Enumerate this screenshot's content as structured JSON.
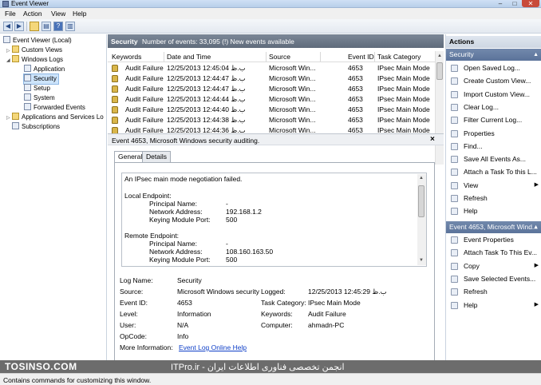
{
  "window": {
    "title": "Event Viewer",
    "minimize": "–",
    "maximize": "□",
    "close": "✕"
  },
  "menu": [
    "File",
    "Action",
    "View",
    "Help"
  ],
  "tree": {
    "root": "Event Viewer (Local)",
    "custom_views": "Custom Views",
    "windows_logs": "Windows Logs",
    "application": "Application",
    "security": "Security",
    "setup": "Setup",
    "system": "System",
    "forwarded": "Forwarded Events",
    "app_services": "Applications and Services Lo",
    "subscriptions": "Subscriptions"
  },
  "list": {
    "log_name": "Security",
    "summary": "Number of events: 33,095 (!) New events available",
    "columns": [
      "Keywords",
      "Date and Time",
      "Source",
      "Event ID",
      "Task Category"
    ],
    "rows": [
      [
        "Audit Failure",
        "12/25/2013 12:45:04 ب.ظ",
        "Microsoft Win...",
        "4653",
        "IPsec Main Mode"
      ],
      [
        "Audit Failure",
        "12/25/2013 12:44:47 ب.ظ",
        "Microsoft Win...",
        "4653",
        "IPsec Main Mode"
      ],
      [
        "Audit Failure",
        "12/25/2013 12:44:47 ب.ظ",
        "Microsoft Win...",
        "4653",
        "IPsec Main Mode"
      ],
      [
        "Audit Failure",
        "12/25/2013 12:44:44 ب.ظ",
        "Microsoft Win...",
        "4653",
        "IPsec Main Mode"
      ],
      [
        "Audit Failure",
        "12/25/2013 12:44:40 ب.ظ",
        "Microsoft Win...",
        "4653",
        "IPsec Main Mode"
      ],
      [
        "Audit Failure",
        "12/25/2013 12:44:38 ب.ظ",
        "Microsoft Win...",
        "4653",
        "IPsec Main Mode"
      ],
      [
        "Audit Failure",
        "12/25/2013 12:44:36 ب.ظ",
        "Microsoft Win...",
        "4653",
        "IPsec Main Mode"
      ]
    ]
  },
  "detail": {
    "header": "Event 4653, Microsoft Windows security auditing.",
    "close": "×",
    "tab_general": "General",
    "tab_details": "Details",
    "message": {
      "l1": "An IPsec main mode negotiation failed.",
      "l2": "Local Endpoint:",
      "l3k": "Principal Name:",
      "l3v": "-",
      "l4k": "Network Address:",
      "l4v": "192.168.1.2",
      "l5k": "Keying Module Port:",
      "l5v": "500",
      "l6": "Remote Endpoint:",
      "l7k": "Principal Name:",
      "l7v": "-",
      "l8k": "Network Address:",
      "l8v": "108.160.163.50",
      "l9k": "Keying Module Port:",
      "l9v": "500"
    },
    "props": {
      "log_name_k": "Log Name:",
      "log_name_v": "Security",
      "source_k": "Source:",
      "source_v": "Microsoft Windows security",
      "logged_k": "Logged:",
      "logged_v": "12/25/2013 12:45:29 ب.ظ",
      "event_id_k": "Event ID:",
      "event_id_v": "4653",
      "task_cat_k": "Task Category:",
      "task_cat_v": "IPsec Main Mode",
      "level_k": "Level:",
      "level_v": "Information",
      "keywords_k": "Keywords:",
      "keywords_v": "Audit Failure",
      "user_k": "User:",
      "user_v": "N/A",
      "computer_k": "Computer:",
      "computer_v": "ahmadn-PC",
      "opcode_k": "OpCode:",
      "opcode_v": "Info",
      "more_k": "More Information:",
      "more_v": "Event Log Online Help"
    }
  },
  "actions": {
    "title": "Actions",
    "sec1": "Security",
    "items1": [
      "Open Saved Log...",
      "Create Custom View...",
      "Import Custom View...",
      "Clear Log...",
      "Filter Current Log...",
      "Properties",
      "Find...",
      "Save All Events As...",
      "Attach a Task To this L...",
      "View",
      "Refresh",
      "Help"
    ],
    "sec2": "Event 4653, Microsoft Wind...",
    "items2": [
      "Event Properties",
      "Attach Task To This Ev...",
      "Copy",
      "Save Selected Events...",
      "Refresh",
      "Help"
    ]
  },
  "watermark": {
    "left": "TOSINSO.COM",
    "right": "ITPro.ir - انجمن تخصصی فناوری اطلاعات ایران"
  },
  "status": "Contains commands for customizing this window."
}
